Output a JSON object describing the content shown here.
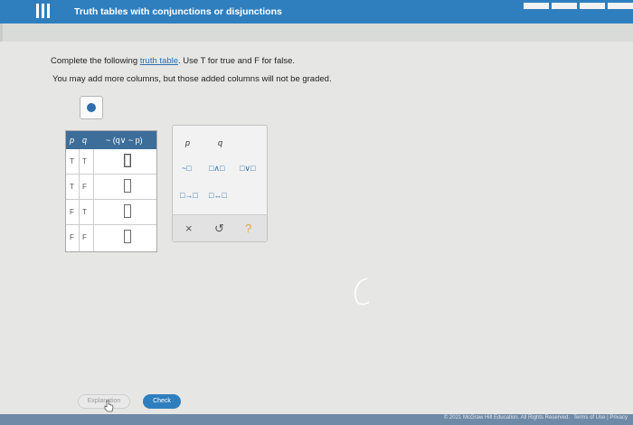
{
  "header": {
    "title": "Truth tables with conjunctions or disjunctions",
    "menu_icon": "hamburger-icon"
  },
  "instructions": {
    "line1_prefix": "Complete the following ",
    "line1_link": "truth table",
    "line1_suffix": ". Use T for true and F for false.",
    "line2": "You may add more columns, but those added columns will not be graded."
  },
  "truth_table": {
    "headers": [
      "p",
      "q",
      "~ (q∨ ~ p)"
    ],
    "rows": [
      {
        "p": "T",
        "q": "T",
        "value": ""
      },
      {
        "p": "T",
        "q": "F",
        "value": ""
      },
      {
        "p": "F",
        "q": "T",
        "value": ""
      },
      {
        "p": "F",
        "q": "F",
        "value": ""
      }
    ]
  },
  "palette": {
    "var_p": "p",
    "var_q": "q",
    "not_symbol": "~□",
    "and_symbol": "□∧□",
    "or_symbol": "□∨□",
    "implies_symbol": "□→□",
    "iff_symbol": "□↔□",
    "clear_label": "×",
    "undo_label": "↺",
    "help_label": "?"
  },
  "actions": {
    "explanation_label": "Explanation",
    "check_label": "Check"
  },
  "footer": {
    "copyright": "© 2021 McGraw Hill Education. All Rights Reserved.",
    "terms": "Terms of Use",
    "privacy": "Privacy"
  },
  "colors": {
    "accent": "#2f7fbf",
    "table_header": "#3d6e9a"
  }
}
